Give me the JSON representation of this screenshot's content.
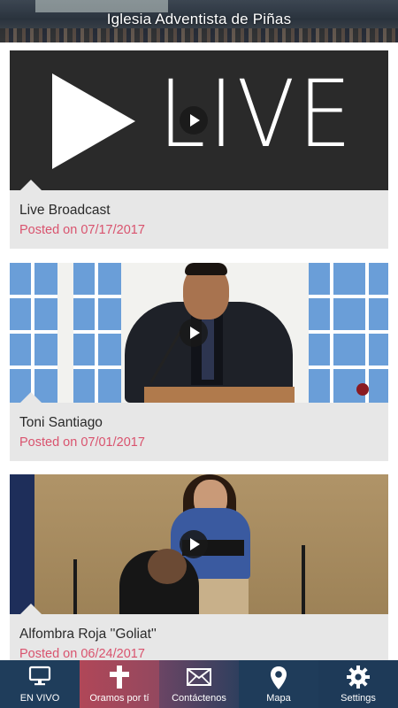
{
  "header": {
    "title": "Iglesia Adventista de Piñas"
  },
  "posts": [
    {
      "title": "Live Broadcast",
      "date": "Posted on 07/17/2017",
      "thumb_text": "LIVE"
    },
    {
      "title": "Toni Santiago",
      "date": "Posted on 07/01/2017"
    },
    {
      "title": "Alfombra Roja ''Goliat''",
      "date": "Posted on 06/24/2017"
    }
  ],
  "tabs": [
    {
      "label": "EN VIVO",
      "icon": "monitor-icon"
    },
    {
      "label": "Oramos por tí",
      "icon": "cross-icon"
    },
    {
      "label": "Contáctenos",
      "icon": "envelope-icon"
    },
    {
      "label": "Mapa",
      "icon": "map-pin-icon"
    },
    {
      "label": "Settings",
      "icon": "gear-icon"
    }
  ],
  "colors": {
    "accent_date": "#d9536e",
    "tabbar": "#1e3a55",
    "tab_active": "#b04758"
  }
}
